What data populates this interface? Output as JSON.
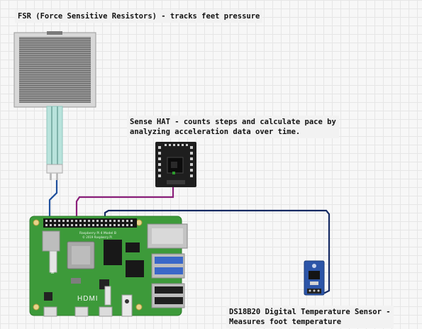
{
  "labels": {
    "fsr": "FSR (Force Sensitive Resistors) - tracks feet pressure",
    "sense_hat_line1": "Sense HAT - counts steps and calculate pace by",
    "sense_hat_line2": "analyzing acceleration data over time.",
    "ds18b20_line1": "DS18B20 Digital Temperature Sensor -",
    "ds18b20_line2": "Measures foot temperature"
  },
  "board": {
    "hdmi_text": "HDMI",
    "model_text": "Raspberry Pi 4 Model B",
    "copyright_text": "© 2019 Raspberry Pi"
  },
  "colors": {
    "pcb_green": "#3d9a3a",
    "wire_blue": "#1f4f9c",
    "wire_purple": "#8a1f7a",
    "wire_navy": "#152a63",
    "usb_blue": "#3a68c8",
    "sensor_blue": "#2c55a8"
  }
}
